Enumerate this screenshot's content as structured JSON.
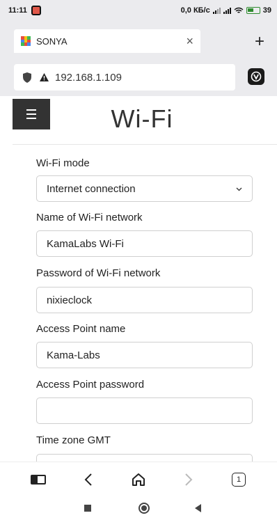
{
  "status_bar": {
    "time": "11:11",
    "net_speed": "0,0 КБ/с",
    "battery": "39"
  },
  "browser": {
    "tab_title": "SONYA",
    "address": "192.168.1.109",
    "tab_count": "1"
  },
  "page": {
    "title": "Wi-Fi",
    "form": {
      "wifi_mode": {
        "label": "Wi-Fi mode",
        "value": "Internet connection"
      },
      "network_name": {
        "label": "Name of Wi-Fi network",
        "value": "KamaLabs Wi-Fi"
      },
      "network_password": {
        "label": "Password of Wi-Fi network",
        "value": "nixieclock"
      },
      "ap_name": {
        "label": "Access Point name",
        "value": "Kama-Labs"
      },
      "ap_password": {
        "label": "Access Point password",
        "value": ""
      },
      "timezone": {
        "label": "Time zone GMT",
        "value": ""
      }
    }
  }
}
